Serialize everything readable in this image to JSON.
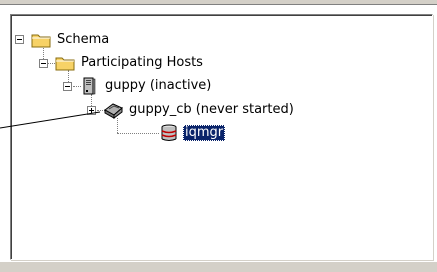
{
  "tree": {
    "nodes": [
      {
        "label": "Schema",
        "icon": "folder-icon",
        "expander": "minus"
      },
      {
        "label": "Participating Hosts",
        "icon": "folder-icon",
        "expander": "minus"
      },
      {
        "label": "guppy (inactive)",
        "icon": "server-icon",
        "expander": "minus"
      },
      {
        "label": "guppy_cb (never started)",
        "icon": "control-broker-icon",
        "expander": "plus"
      },
      {
        "label": "iqmgr",
        "icon": "database-icon",
        "expander": "none",
        "selected": true
      }
    ]
  },
  "colors": {
    "selection": "#0a246a",
    "folder": "#f7d266",
    "panel_face": "#d4d0c8"
  }
}
